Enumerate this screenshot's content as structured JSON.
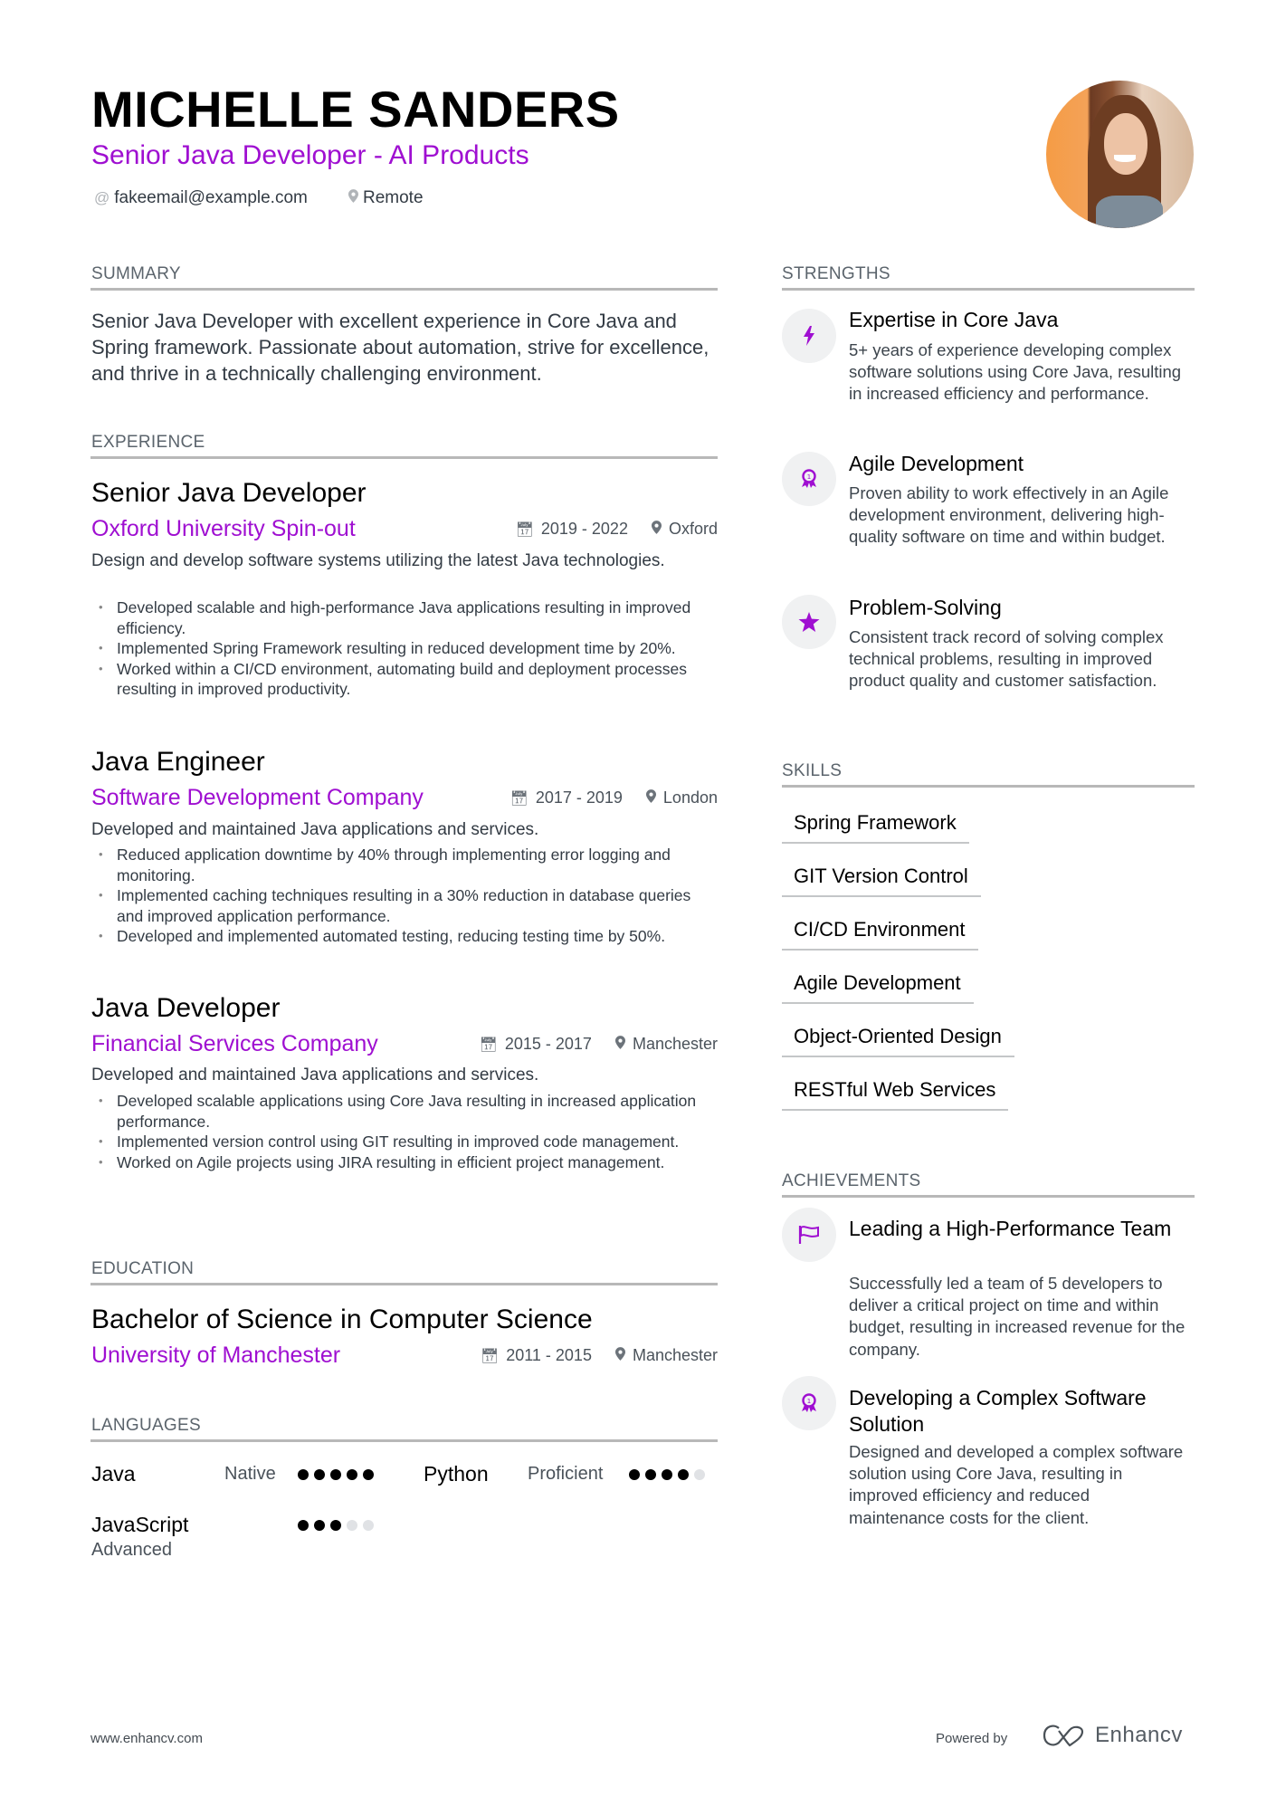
{
  "header": {
    "name": "MICHELLE SANDERS",
    "title": "Senior Java Developer - AI Products",
    "email": "fakeemail@example.com",
    "location": "Remote",
    "email_icon": "at-icon",
    "location_icon": "map-pin-icon",
    "photo_alt": "Profile photo"
  },
  "colors": {
    "accent": "#9f0fd1",
    "rule": "#b8b8b8",
    "icon_bg": "#f0f1f2"
  },
  "summary": {
    "heading": "SUMMARY",
    "text": "Senior Java Developer with excellent experience in Core Java and Spring framework. Passionate about automation, strive for excellence, and thrive in a technically challenging environment."
  },
  "experience": {
    "heading": "EXPERIENCE",
    "jobs": [
      {
        "title": "Senior Java Developer",
        "company": "Oxford University Spin-out",
        "dates": "2019 - 2022",
        "location": "Oxford",
        "description": "Design and develop software systems utilizing the latest Java technologies.",
        "bullets": [
          "Developed scalable and high-performance Java applications resulting in improved efficiency.",
          "Implemented Spring Framework resulting in reduced development time by 20%.",
          "Worked within a CI/CD environment, automating build and deployment processes resulting in improved productivity."
        ]
      },
      {
        "title": "Java Engineer",
        "company": "Software Development Company",
        "dates": "2017 - 2019",
        "location": "London",
        "description": "Developed and maintained Java applications and services.",
        "bullets": [
          "Reduced application downtime by 40% through implementing error logging and monitoring.",
          "Implemented caching techniques resulting in a 30% reduction in database queries and improved application performance.",
          "Developed and implemented automated testing, reducing testing time by 50%."
        ]
      },
      {
        "title": "Java Developer",
        "company": "Financial Services Company",
        "dates": "2015 - 2017",
        "location": "Manchester",
        "description": "Developed and maintained Java applications and services.",
        "bullets": [
          "Developed scalable applications using Core Java resulting in increased application performance.",
          "Implemented version control using GIT resulting in improved code management.",
          "Worked on Agile projects using JIRA resulting in efficient project management."
        ]
      }
    ]
  },
  "education": {
    "heading": "EDUCATION",
    "degree": "Bachelor of Science in Computer Science",
    "school": "University of Manchester",
    "dates": "2011 - 2015",
    "location": "Manchester"
  },
  "languages": {
    "heading": "LANGUAGES",
    "items": [
      {
        "name": "Java",
        "level": "Native",
        "rating": 5,
        "max": 5
      },
      {
        "name": "Python",
        "level": "Proficient",
        "rating": 4,
        "max": 5
      },
      {
        "name": "JavaScript",
        "level": "Advanced",
        "rating": 3,
        "max": 5
      }
    ]
  },
  "strengths": {
    "heading": "STRENGTHS",
    "items": [
      {
        "icon": "lightning-bolt-icon",
        "title": "Expertise in Core Java",
        "description": "5+ years of experience developing complex software solutions using Core Java, resulting in increased efficiency and performance."
      },
      {
        "icon": "award-ribbon-icon",
        "title": "Agile Development",
        "description": "Proven ability to work effectively in an Agile development environment, delivering high-quality software on time and within budget."
      },
      {
        "icon": "star-icon",
        "title": "Problem-Solving",
        "description": "Consistent track record of solving complex technical problems, resulting in improved product quality and customer satisfaction."
      }
    ]
  },
  "skills": {
    "heading": "SKILLS",
    "items": [
      "Spring Framework",
      "GIT Version Control",
      "CI/CD Environment",
      "Agile Development",
      "Object-Oriented Design",
      "RESTful Web Services"
    ]
  },
  "achievements": {
    "heading": "ACHIEVEMENTS",
    "items": [
      {
        "icon": "flag-icon",
        "title": "Leading a High-Performance Team",
        "description": "Successfully led a team of 5 developers to deliver a critical project on time and within budget, resulting in increased revenue for the company."
      },
      {
        "icon": "award-ribbon-icon",
        "title": "Developing a Complex Software Solution",
        "description": "Designed and developed a complex software solution using Core Java, resulting in improved efficiency and reduced maintenance costs for the client."
      }
    ]
  },
  "footer": {
    "website": "www.enhancv.com",
    "powered_by": "Powered by",
    "brand": "Enhancv"
  }
}
